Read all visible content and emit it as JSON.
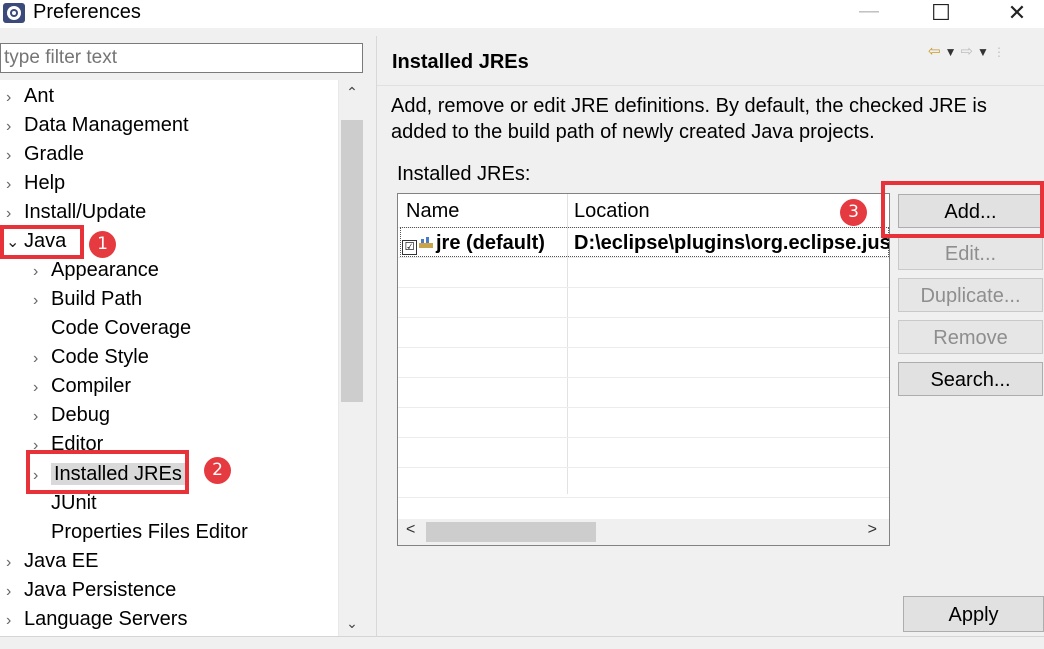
{
  "window": {
    "title": "Preferences",
    "minimize_glyph": "—",
    "maximize_glyph": "☐",
    "close_glyph": "✕"
  },
  "filter": {
    "placeholder": "type filter text",
    "value": ""
  },
  "tree": {
    "items": [
      {
        "label": "Ant",
        "expander": "›"
      },
      {
        "label": "Data Management",
        "expander": "›"
      },
      {
        "label": "Gradle",
        "expander": "›"
      },
      {
        "label": "Help",
        "expander": "›"
      },
      {
        "label": "Install/Update",
        "expander": "›"
      },
      {
        "label": "Java",
        "expander": "⌄"
      },
      {
        "label": "Appearance",
        "expander": "›"
      },
      {
        "label": "Build Path",
        "expander": "›"
      },
      {
        "label": "Code Coverage",
        "expander": ""
      },
      {
        "label": "Code Style",
        "expander": "›"
      },
      {
        "label": "Compiler",
        "expander": "›"
      },
      {
        "label": "Debug",
        "expander": "›"
      },
      {
        "label": "Editor",
        "expander": "›"
      },
      {
        "label": "Installed JREs",
        "expander": "›"
      },
      {
        "label": "JUnit",
        "expander": ""
      },
      {
        "label": "Properties Files Editor",
        "expander": ""
      },
      {
        "label": "Java EE",
        "expander": "›"
      },
      {
        "label": "Java Persistence",
        "expander": "›"
      },
      {
        "label": "Language Servers",
        "expander": "›"
      }
    ],
    "scroll_up": "⌃",
    "scroll_down": "⌄"
  },
  "page": {
    "title": "Installed JREs",
    "description": "Add, remove or edit JRE definitions. By default, the checked JRE is added to the build path of newly created Java projects.",
    "table_caption": "Installed JREs:"
  },
  "table": {
    "columns": [
      "Name",
      "Location"
    ],
    "rows": [
      {
        "name": "jre (default)",
        "location": "D:\\eclipse\\plugins\\org.eclipse.justj.openjdk",
        "checked": "☑"
      }
    ],
    "scroll_left": "<",
    "scroll_right": ">"
  },
  "buttons": {
    "add": "Add...",
    "edit": "Edit...",
    "duplicate": "Duplicate...",
    "remove": "Remove",
    "search": "Search...",
    "apply": "Apply"
  },
  "annotations": {
    "badge1": "1",
    "badge2": "2",
    "badge3": "3"
  },
  "colors": {
    "highlight": "#e8323a",
    "selection": "#d9d9d9",
    "nav_arrow": "#c89a2a"
  }
}
